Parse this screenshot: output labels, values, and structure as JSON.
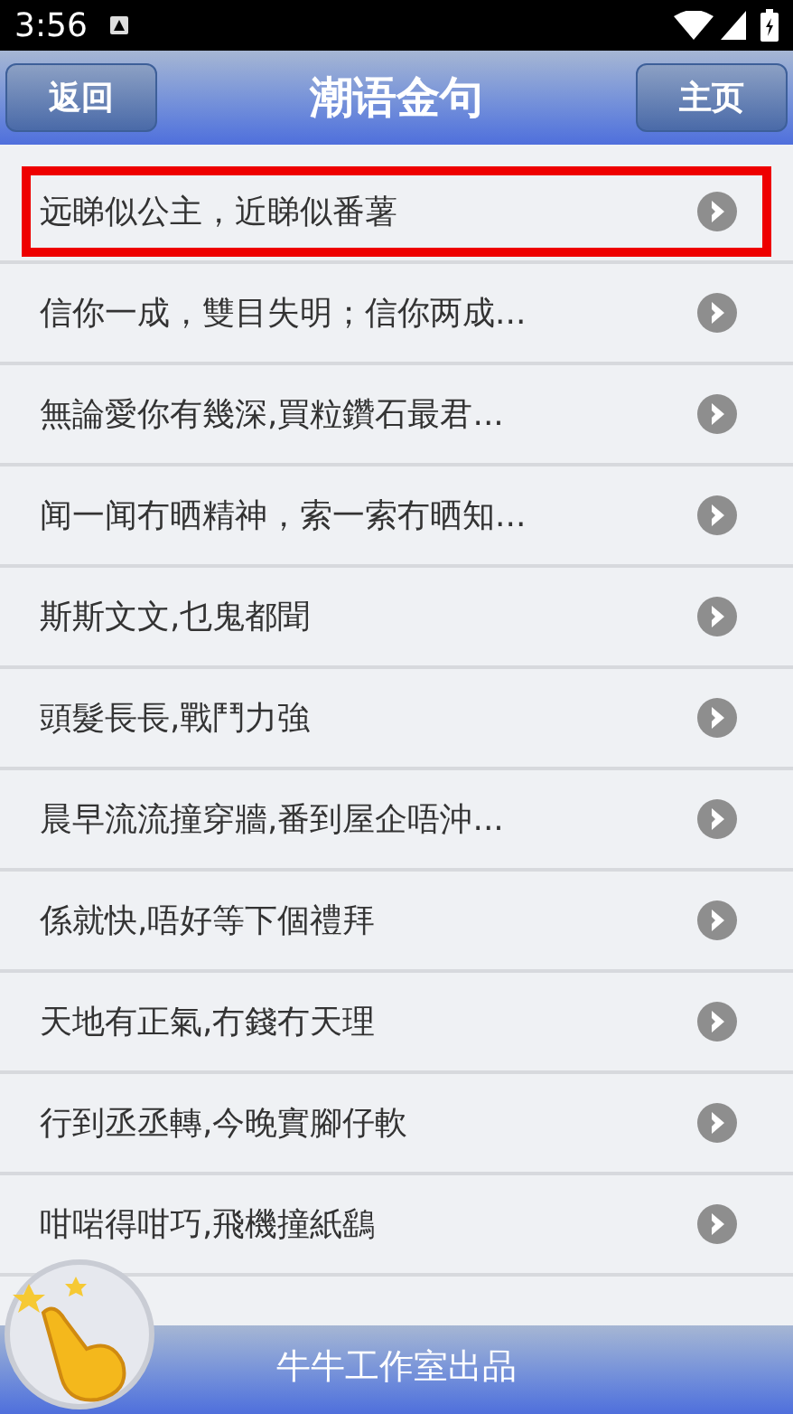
{
  "status_bar": {
    "time": "3:56"
  },
  "header": {
    "back_button": "返回",
    "title": "潮语金句",
    "home_button": "主页"
  },
  "list": [
    {
      "text": "远睇似公主，近睇似番薯",
      "selected": true
    },
    {
      "text": "信你一成，雙目失明；信你两成...",
      "selected": false
    },
    {
      "text": "無論愛你有幾深,買粒鑽石最君...",
      "selected": false
    },
    {
      "text": "闻一闻冇晒精神，索一索冇晒知...",
      "selected": false
    },
    {
      "text": "斯斯文文,乜鬼都聞",
      "selected": false
    },
    {
      "text": "頭髮長長,戰鬥力強",
      "selected": false
    },
    {
      "text": "晨早流流撞穿牆,番到屋企唔沖...",
      "selected": false
    },
    {
      "text": "係就快,唔好等下個禮拜",
      "selected": false
    },
    {
      "text": "天地有正氣,冇錢冇天理",
      "selected": false
    },
    {
      "text": "行到丞丞轉,今晚實腳仔軟",
      "selected": false
    },
    {
      "text": "咁啱得咁巧,飛機撞紙鷂",
      "selected": false
    }
  ],
  "footer": {
    "text": "牛牛工作室出品"
  }
}
